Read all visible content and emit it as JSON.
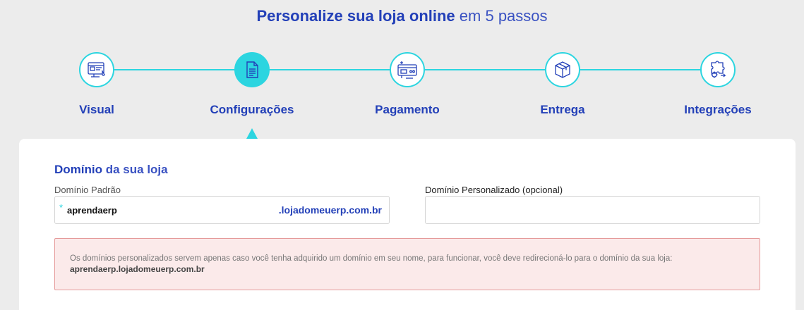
{
  "header": {
    "title_bold": "Personalize sua loja online",
    "title_light": "em 5 passos"
  },
  "steps": [
    {
      "label": "Visual",
      "icon": "visual-icon",
      "active": false
    },
    {
      "label": "Configurações",
      "icon": "document-icon",
      "active": true
    },
    {
      "label": "Pagamento",
      "icon": "payment-icon",
      "active": false
    },
    {
      "label": "Entrega",
      "icon": "box-icon",
      "active": false
    },
    {
      "label": "Integrações",
      "icon": "puzzle-gear-icon",
      "active": false
    }
  ],
  "domain_section": {
    "title_bold": "Domínio",
    "title_light": "da sua loja",
    "default_label": "Domínio Padrão",
    "required_mark": "*",
    "subdomain_value": "aprendaerp",
    "suffix": ".lojadomeuerp.com.br",
    "custom_label": "Domínio Personalizado (opcional)",
    "custom_value": ""
  },
  "alert": {
    "message": "Os domínios personalizados servem apenas caso você tenha adquirido um domínio em seu nome, para funcionar, você deve redirecioná-lo para o domínio da sua loja:",
    "domain": "aprendaerp.lojadomeuerp.com.br"
  },
  "colors": {
    "accent": "#2cd5e0",
    "primary_text": "#2340b8",
    "alert_bg": "#fbeaea",
    "alert_border": "#e59a9a"
  }
}
